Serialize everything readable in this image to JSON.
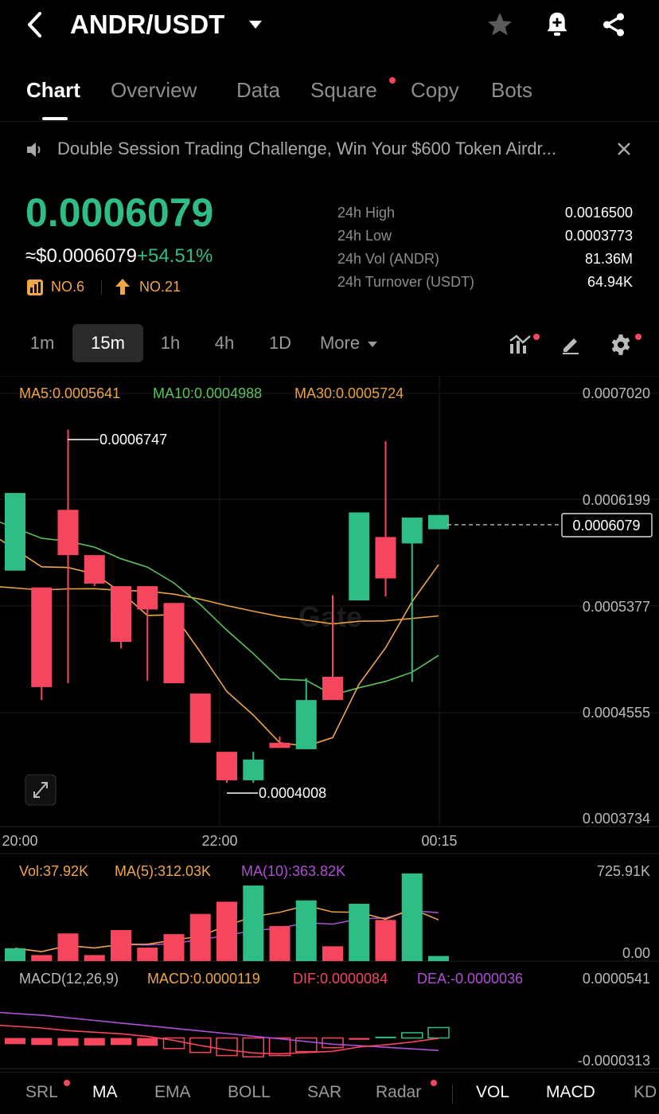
{
  "header": {
    "pair": "ANDR/USDT"
  },
  "tabs": [
    {
      "label": "Chart",
      "active": true
    },
    {
      "label": "Overview"
    },
    {
      "label": "Data"
    },
    {
      "label": "Square",
      "dot": true
    },
    {
      "label": "Copy"
    },
    {
      "label": "Bots"
    }
  ],
  "banner": {
    "text": "Double Session Trading Challenge, Win Your $600 Token Airdr..."
  },
  "ticker": {
    "price": "0.0006079",
    "usd_price": "≈$0.0006079",
    "change": "+54.51%",
    "rank1": "NO.6",
    "rank2": "NO.21",
    "stats": [
      {
        "label": "24h High",
        "value": "0.0016500"
      },
      {
        "label": "24h Low",
        "value": "0.0003773"
      },
      {
        "label": "24h Vol (ANDR)",
        "value": "81.36M"
      },
      {
        "label": "24h Turnover (USDT)",
        "value": "64.94K"
      }
    ]
  },
  "intervals": [
    "1m",
    "15m",
    "1h",
    "4h",
    "1D",
    "More"
  ],
  "active_interval": "15m",
  "ma_legend": {
    "ma5": "MA5:0.0005641",
    "ma10": "MA10:0.0004988",
    "ma30": "MA30:0.0005724"
  },
  "annotations": {
    "high": "0.0006747",
    "low": "0.0004008",
    "current": "0.0006079"
  },
  "watermark": "Gate",
  "vol_legend": {
    "vol": "Vol:37.92K",
    "ma5": "MA(5):312.03K",
    "ma10": "MA(10):363.82K",
    "max": "725.91K",
    "min": "0.00"
  },
  "macd_legend": {
    "title": "MACD(12,26,9)",
    "macd": "MACD:0.0000119",
    "dif": "DIF:0.0000084",
    "dea": "DEA:-0.0000036",
    "max": "0.0000541",
    "min": "-0.0000313"
  },
  "indicators": [
    {
      "label": "SRL",
      "dot": true
    },
    {
      "label": "MA",
      "on": true
    },
    {
      "label": "EMA"
    },
    {
      "label": "BOLL"
    },
    {
      "label": "SAR"
    },
    {
      "label": "Radar",
      "dot": true
    },
    {
      "label": "VOL",
      "on": true
    },
    {
      "label": "MACD",
      "on": true
    },
    {
      "label": "KD"
    }
  ],
  "colors": {
    "up": "#2ebd85",
    "down": "#f6465d",
    "ma5": "#f0a646",
    "ma10": "#5bc25b",
    "ma30": "#e8a23c",
    "dea": "#b04fd6"
  },
  "chart_data": {
    "type": "candlestick",
    "x_ticks": [
      "20:00",
      "22:00",
      "00:15"
    ],
    "y_ticks": [
      "0.0007020",
      "0.0006199",
      "0.0005377",
      "0.0004555",
      "0.0003734"
    ],
    "ylim": [
      0.0003734,
      0.000702
    ],
    "candles": [
      {
        "o": 0.000565,
        "h": 0.000625,
        "l": 0.000565,
        "c": 0.000625
      },
      {
        "o": 0.000552,
        "h": 0.000552,
        "l": 0.000465,
        "c": 0.000475
      },
      {
        "o": 0.000612,
        "h": 0.000674,
        "l": 0.000478,
        "c": 0.000577
      },
      {
        "o": 0.000577,
        "h": 0.000577,
        "l": 0.000553,
        "c": 0.000555
      },
      {
        "o": 0.000553,
        "h": 0.000553,
        "l": 0.000505,
        "c": 0.00051
      },
      {
        "o": 0.000553,
        "h": 0.000553,
        "l": 0.00048,
        "c": 0.000535
      },
      {
        "o": 0.00054,
        "h": 0.00054,
        "l": 0.000478,
        "c": 0.000478
      },
      {
        "o": 0.00047,
        "h": 0.00047,
        "l": 0.000432,
        "c": 0.000432
      },
      {
        "o": 0.000425,
        "h": 0.000425,
        "l": 0.000401,
        "c": 0.000403
      },
      {
        "o": 0.000403,
        "h": 0.000425,
        "l": 0.000401,
        "c": 0.000419
      },
      {
        "o": 0.000432,
        "h": 0.000437,
        "l": 0.000428,
        "c": 0.000428
      },
      {
        "o": 0.000427,
        "h": 0.000482,
        "l": 0.000427,
        "c": 0.000465
      },
      {
        "o": 0.000483,
        "h": 0.000546,
        "l": 0.000465,
        "c": 0.000465
      },
      {
        "o": 0.000542,
        "h": 0.00061,
        "l": 0.000542,
        "c": 0.00061
      },
      {
        "o": 0.000591,
        "h": 0.000665,
        "l": 0.000545,
        "c": 0.000559
      },
      {
        "o": 0.000586,
        "h": 0.000606,
        "l": 0.000479,
        "c": 0.000606
      },
      {
        "o": 0.000597,
        "h": 0.000608,
        "l": 0.000597,
        "c": 0.000608
      }
    ],
    "volumes": [
      {
        "v": 95000,
        "up": true
      },
      {
        "v": 45000,
        "up": false
      },
      {
        "v": 205000,
        "up": false
      },
      {
        "v": 45000,
        "up": false
      },
      {
        "v": 230000,
        "up": false
      },
      {
        "v": 100000,
        "up": false
      },
      {
        "v": 200000,
        "up": false
      },
      {
        "v": 350000,
        "up": false
      },
      {
        "v": 440000,
        "up": false
      },
      {
        "v": 560000,
        "up": true
      },
      {
        "v": 260000,
        "up": false
      },
      {
        "v": 450000,
        "up": true
      },
      {
        "v": 110000,
        "up": false
      },
      {
        "v": 425000,
        "up": true
      },
      {
        "v": 305000,
        "up": false
      },
      {
        "v": 650000,
        "up": true
      },
      {
        "v": 37920,
        "up": true
      }
    ],
    "vol_ylim": [
      0,
      725910
    ],
    "macd_hist": [
      -7e-06,
      -8e-06,
      -9e-06,
      -8.5e-06,
      -8e-06,
      -9e-06,
      -1.2e-05,
      -1.65e-05,
      -2e-05,
      -2.15e-05,
      -2e-05,
      -1.55e-05,
      -1.1e-05,
      -2e-06,
      1.5e-06,
      6e-06,
      1.19e-05
    ],
    "macd_ylim": [
      -3.13e-05,
      5.41e-05
    ]
  }
}
